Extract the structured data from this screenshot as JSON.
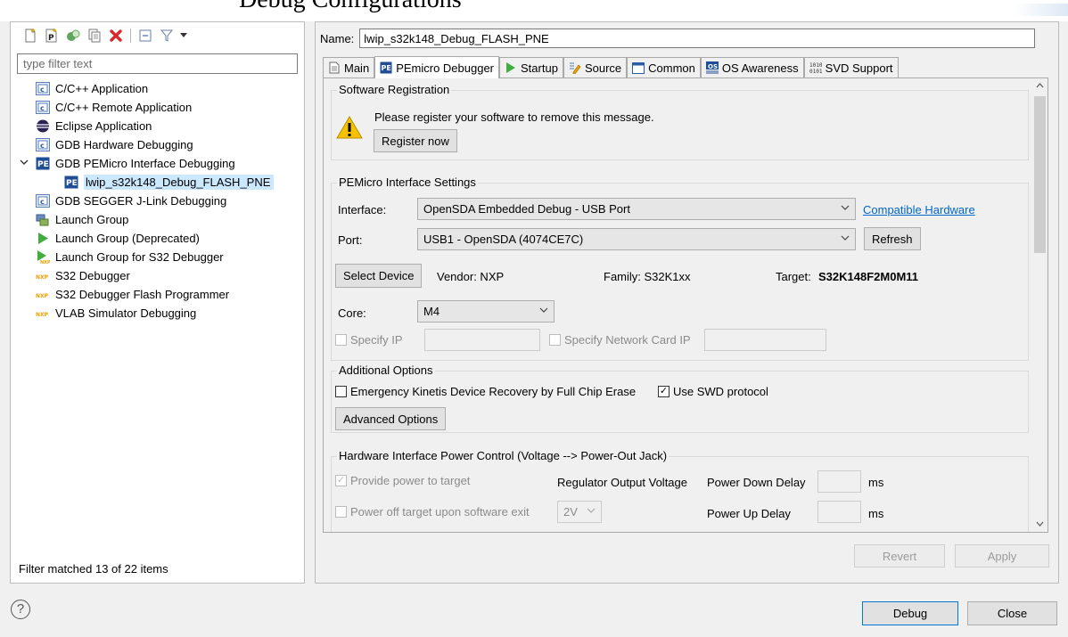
{
  "top_text": "Debug Configurations",
  "sidebar": {
    "filter_placeholder": "type filter text",
    "items": [
      {
        "label": "C/C++ Application"
      },
      {
        "label": "C/C++ Remote Application"
      },
      {
        "label": "Eclipse Application"
      },
      {
        "label": "GDB Hardware Debugging"
      },
      {
        "label": "GDB PEMicro Interface Debugging"
      },
      {
        "label": "lwip_s32k148_Debug_FLASH_PNE"
      },
      {
        "label": "GDB SEGGER J-Link Debugging"
      },
      {
        "label": "Launch Group"
      },
      {
        "label": "Launch Group (Deprecated)"
      },
      {
        "label": "Launch Group for S32 Debugger"
      },
      {
        "label": "S32 Debugger"
      },
      {
        "label": "S32 Debugger Flash Programmer"
      },
      {
        "label": "VLAB Simulator Debugging"
      }
    ],
    "status": "Filter matched 13 of 22 items"
  },
  "main": {
    "name_label": "Name:",
    "name_value": "lwip_s32k148_Debug_FLASH_PNE",
    "tabs": [
      {
        "label": "Main"
      },
      {
        "label": "PEmicro Debugger"
      },
      {
        "label": "Startup"
      },
      {
        "label": "Source"
      },
      {
        "label": "Common"
      },
      {
        "label": "OS Awareness"
      },
      {
        "label": "SVD Support"
      }
    ],
    "registration": {
      "title": "Software Registration",
      "message": "Please register your software to remove this message.",
      "button": "Register now"
    },
    "interface": {
      "title": "PEMicro Interface Settings",
      "interface_label": "Interface:",
      "interface_value": "OpenSDA Embedded Debug - USB Port",
      "compat_link": "Compatible Hardware",
      "port_label": "Port:",
      "port_value": "USB1 - OpenSDA (4074CE7C)",
      "refresh": "Refresh",
      "select_device": "Select Device",
      "vendor": "Vendor: NXP",
      "family": "Family: S32K1xx",
      "target_label": "Target:",
      "target_value": "S32K148F2M0M11",
      "core_label": "Core:",
      "core_value": "M4",
      "specify_ip": "Specify IP",
      "specify_card": "Specify Network Card IP"
    },
    "additional": {
      "title": "Additional Options",
      "emergency": "Emergency Kinetis Device Recovery by Full Chip Erase",
      "swd": "Use SWD protocol",
      "advanced": "Advanced Options"
    },
    "power": {
      "title": "Hardware Interface Power Control (Voltage --> Power-Out Jack)",
      "provide": "Provide power to target",
      "regulator": "Regulator Output Voltage",
      "power_down": "Power Down Delay",
      "ms1": "ms",
      "power_off": "Power off target upon software exit",
      "voltage": "2V",
      "power_up": "Power Up Delay",
      "ms2": "ms"
    },
    "revert": "Revert",
    "apply": "Apply"
  },
  "footer": {
    "help": "?",
    "debug": "Debug",
    "close": "Close"
  }
}
